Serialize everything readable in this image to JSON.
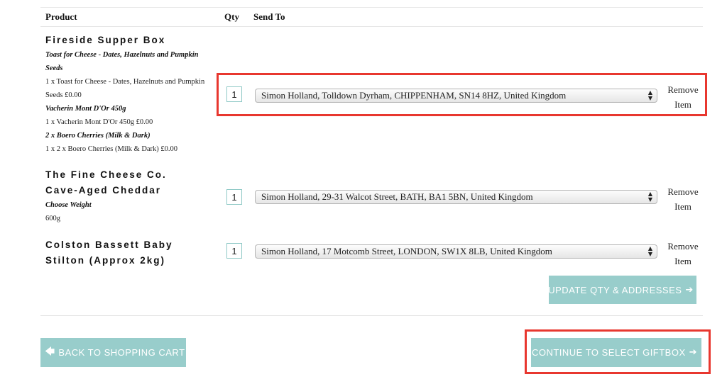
{
  "table": {
    "headers": {
      "product": "Product",
      "qty": "Qty",
      "send_to": "Send To"
    }
  },
  "items": [
    {
      "name": "Fireside Supper Box",
      "options": [
        {
          "title": "Toast for Cheese - Dates, Hazelnuts and Pumpkin Seeds",
          "detail": "1 x Toast for Cheese - Dates, Hazelnuts and Pumpkin Seeds £0.00"
        },
        {
          "title": "Vacherin Mont D'Or 450g",
          "detail": "1 x Vacherin Mont D'Or 450g £0.00"
        },
        {
          "title": "2 x Boero Cherries (Milk & Dark)",
          "detail": "1 x 2 x Boero Cherries (Milk & Dark) £0.00"
        }
      ],
      "qty": "1",
      "address": "Simon Holland, Tolldown Dyrham, CHIPPENHAM, SN14 8HZ, United Kingdom",
      "remove_label_1": "Remove",
      "remove_label_2": "Item"
    },
    {
      "name": "The Fine Cheese Co. Cave-Aged Cheddar",
      "options": [
        {
          "title": "Choose Weight",
          "detail": "600g"
        }
      ],
      "qty": "1",
      "address": "Simon Holland, 29-31 Walcot Street, BATH, BA1 5BN, United Kingdom",
      "remove_label_1": "Remove",
      "remove_label_2": "Item"
    },
    {
      "name": "Colston Bassett Baby Stilton (Approx 2kg)",
      "options": [],
      "qty": "1",
      "address": "Simon Holland, 17 Motcomb Street, LONDON, SW1X 8LB, United Kingdom",
      "remove_label_1": "Remove",
      "remove_label_2": "Item"
    }
  ],
  "buttons": {
    "update": "UPDATE QTY & ADDRESSES",
    "back": "BACK TO SHOPPING CART",
    "continue": "CONTINUE TO SELECT GIFTBOX"
  },
  "icons": {
    "arrow_right": "arrow-right-icon",
    "arrow_left": "arrow-left-icon",
    "select_arrows": "updown-arrows-icon"
  },
  "colors": {
    "button_bg": "#98cdcb",
    "highlight": "#e8372f",
    "qty_border": "#8fc9c6"
  }
}
